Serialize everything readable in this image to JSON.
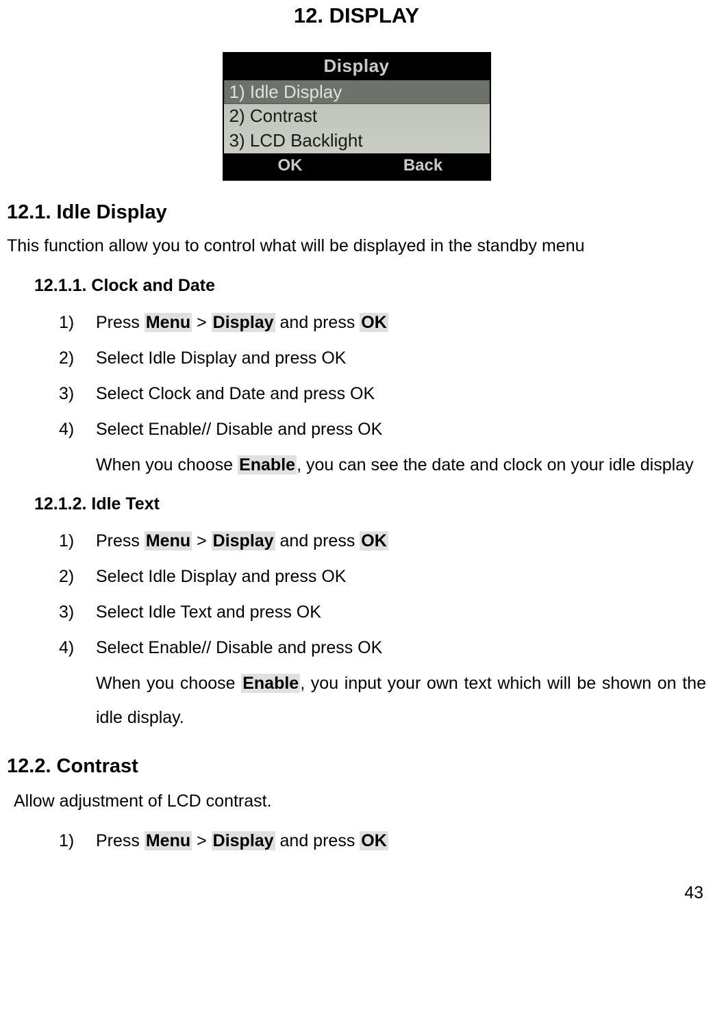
{
  "mainTitle": "12. DISPLAY",
  "lcd": {
    "title": "Display",
    "items": [
      "1) Idle Display",
      "2) Contrast",
      "3) LCD Backlight"
    ],
    "ok": "OK",
    "back": "Back"
  },
  "s12_1": {
    "heading": "12.1. Idle Display",
    "desc": "This function allow you to control what will be displayed in the standby menu"
  },
  "s12_1_1": {
    "heading": "12.1.1. Clock and Date",
    "steps": {
      "n1": "1)",
      "t1a": "Press ",
      "t1_menu": "Menu",
      "t1_gt": " > ",
      "t1_display": "Display",
      "t1b": " and press ",
      "t1_ok": "OK",
      "n2": "2)",
      "t2": "Select Idle Display and press OK",
      "n3": "3)",
      "t3": "Select Clock and Date and press OK",
      "n4": "4)",
      "t4": "Select Enable// Disable and press OK",
      "note_a": "When you choose ",
      "note_enable": "Enable",
      "note_b": ", you can see the date and clock on your idle display"
    }
  },
  "s12_1_2": {
    "heading": "12.1.2. Idle Text",
    "steps": {
      "n1": "1)",
      "t1a": "Press ",
      "t1_menu": "Menu",
      "t1_gt": " > ",
      "t1_display": "Display",
      "t1b": " and press ",
      "t1_ok": "OK",
      "n2": "2)",
      "t2": "Select Idle Display and press OK",
      "n3": "3)",
      "t3": "Select Idle Text and press OK",
      "n4": "4)",
      "t4": "Select Enable// Disable and press OK",
      "note_a": "When you choose ",
      "note_enable": "Enable",
      "note_b": ", you input your own text which will be shown on the idle display."
    }
  },
  "s12_2": {
    "heading": "12.2. Contrast",
    "desc": "Allow adjustment of LCD contrast.",
    "steps": {
      "n1": "1)",
      "t1a": "Press ",
      "t1_menu": "Menu",
      "t1_gt": " > ",
      "t1_display": "Display",
      "t1b": " and press ",
      "t1_ok": "OK"
    }
  },
  "pageNumber": "43"
}
